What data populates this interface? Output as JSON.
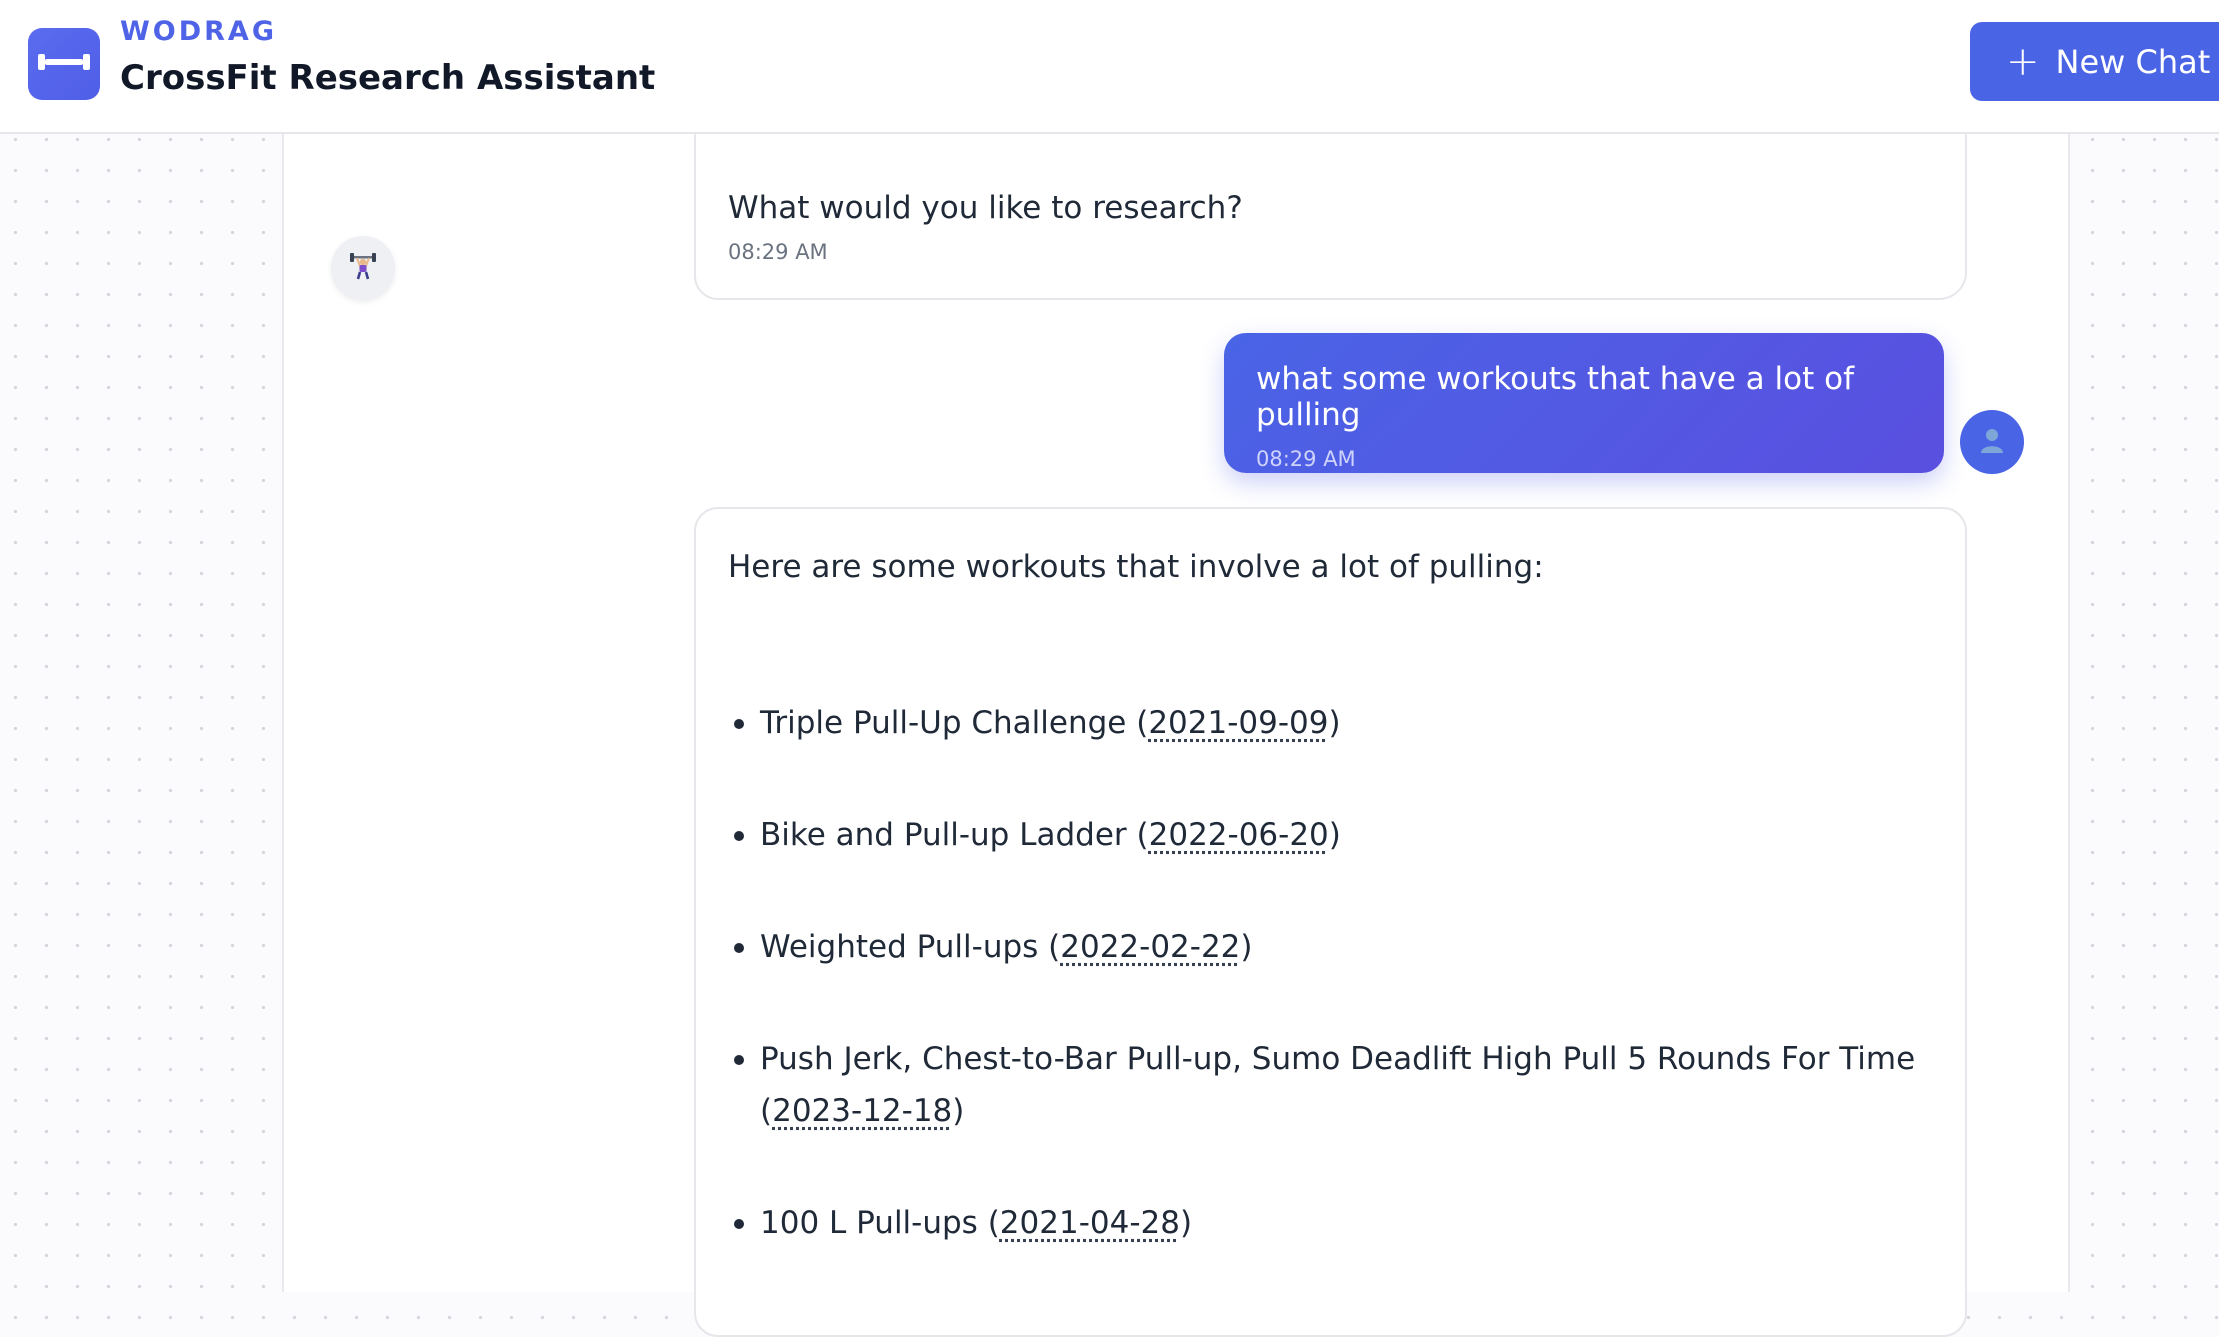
{
  "header": {
    "brand": "WODRAG",
    "title": "CrossFit Research Assistant",
    "new_chat_icon": "plus-icon",
    "new_chat_label": "New Chat",
    "logo_icon": "dumbbell-icon"
  },
  "colors": {
    "accent": "#4a64e6",
    "user_bubble": "#5059e3"
  },
  "messages": [
    {
      "role": "assistant",
      "text": "What would you like to research?",
      "time": "08:29 AM",
      "avatar_icon": "weightlifter-icon"
    },
    {
      "role": "user",
      "text": "what some workouts that have a lot of pulling",
      "time": "08:29 AM",
      "avatar_icon": "user-icon"
    },
    {
      "role": "assistant",
      "intro": "Here are some workouts that involve a lot of pulling:",
      "items": [
        {
          "name": "Triple Pull-Up Challenge",
          "date": "2021-09-09"
        },
        {
          "name": "Bike and Pull-up Ladder",
          "date": "2022-06-20"
        },
        {
          "name": "Weighted Pull-ups",
          "date": "2022-02-22"
        },
        {
          "name": "Push Jerk, Chest-to-Bar Pull-up, Sumo Deadlift High Pull 5 Rounds For Time",
          "date": "2023-12-18"
        },
        {
          "name": "100 L Pull-ups",
          "date": "2021-04-28"
        }
      ]
    }
  ]
}
